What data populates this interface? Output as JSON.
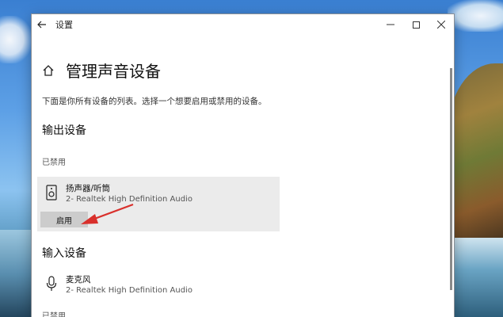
{
  "window": {
    "title": "设置",
    "back_icon": "back-arrow-icon",
    "controls": {
      "minimize": "—",
      "maximize": "□",
      "close": "✕"
    }
  },
  "page": {
    "title": "管理声音设备",
    "description": "下面是你所有设备的列表。选择一个想要启用或禁用的设备。"
  },
  "output": {
    "section_title": "输出设备",
    "status": "已禁用",
    "device": {
      "name": "扬声器/听筒",
      "driver": "2- Realtek High Definition Audio",
      "icon": "speaker-icon"
    },
    "enable_label": "启用"
  },
  "input": {
    "section_title": "输入设备",
    "device": {
      "name": "麦克风",
      "driver": "2- Realtek High Definition Audio",
      "icon": "microphone-icon"
    },
    "status": "已禁用"
  },
  "colors": {
    "annotation_arrow": "#d9302c",
    "card_background": "#ebebeb",
    "button_background": "#cccccc"
  }
}
